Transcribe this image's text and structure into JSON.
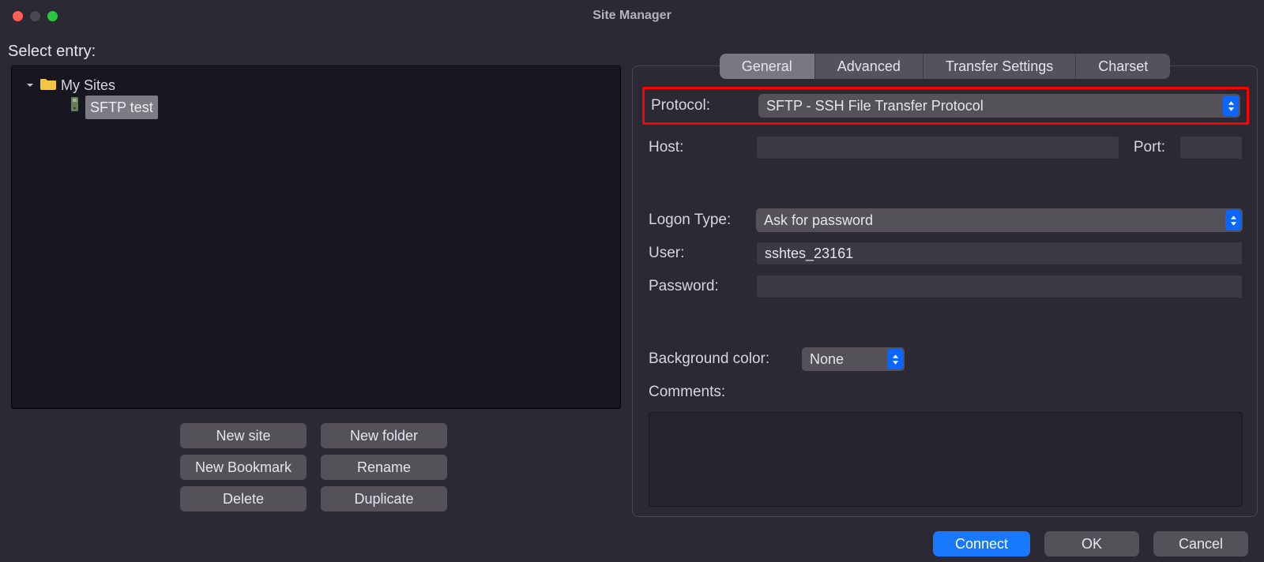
{
  "window": {
    "title": "Site Manager"
  },
  "left": {
    "select_label": "Select entry:",
    "root_label": "My Sites",
    "site_label": "SFTP test"
  },
  "site_buttons": {
    "new_site": "New site",
    "new_folder": "New folder",
    "new_bookmark": "New Bookmark",
    "rename": "Rename",
    "delete": "Delete",
    "duplicate": "Duplicate"
  },
  "tabs": {
    "general": "General",
    "advanced": "Advanced",
    "transfer": "Transfer Settings",
    "charset": "Charset"
  },
  "form": {
    "protocol_label": "Protocol:",
    "protocol_value": "SFTP - SSH File Transfer Protocol",
    "host_label": "Host:",
    "host_value": "",
    "port_label": "Port:",
    "port_value": "",
    "logon_label": "Logon Type:",
    "logon_value": "Ask for password",
    "user_label": "User:",
    "user_value": "sshtes_23161",
    "password_label": "Password:",
    "password_value": "",
    "bgcolor_label": "Background color:",
    "bgcolor_value": "None",
    "comments_label": "Comments:"
  },
  "bottom": {
    "connect": "Connect",
    "ok": "OK",
    "cancel": "Cancel"
  }
}
